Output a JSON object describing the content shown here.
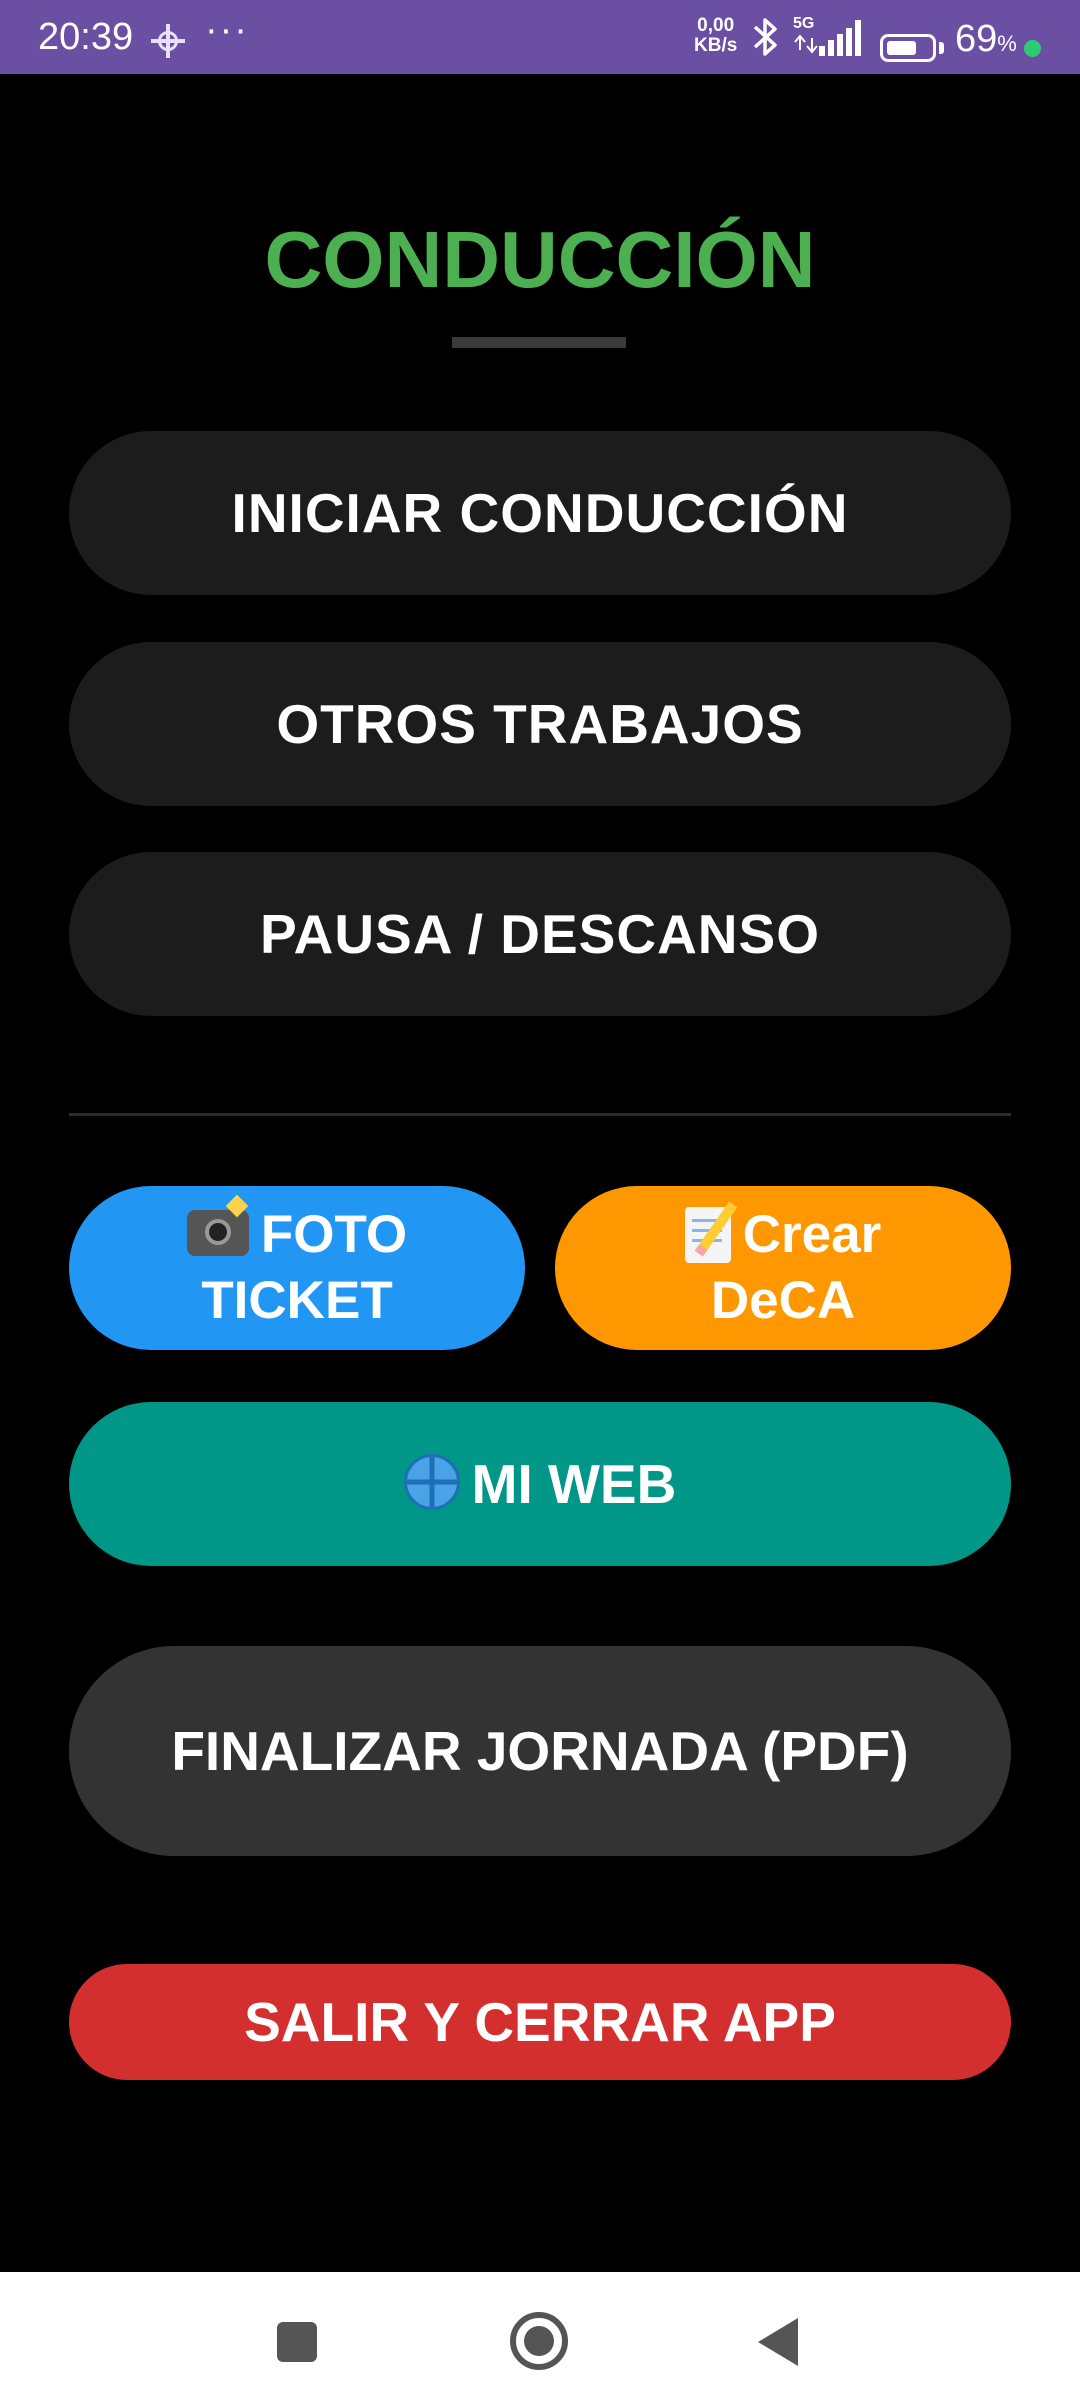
{
  "status_bar": {
    "time": "20:39",
    "more": "···",
    "speed_value": "0,00",
    "speed_unit": "KB/s",
    "network": "5G",
    "battery_percent": "69",
    "battery_unit": "%",
    "battery_level": 0.69,
    "dot_color": "#2ecc71"
  },
  "screen": {
    "title": "CONDUCCIÓN",
    "title_color": "#4caf50"
  },
  "buttons": {
    "start_driving": "INICIAR CONDUCCIÓN",
    "other_work": "OTROS TRABAJOS",
    "pause": "PAUSA / DESCANSO",
    "photo_ticket": {
      "icon": "camera-flash-icon",
      "line1": "FOTO",
      "line2": "TICKET",
      "color": "#2196f3"
    },
    "create_deca": {
      "icon": "memo-icon",
      "line1": "Crear",
      "line2": "DeCA",
      "color": "#ff9800"
    },
    "my_web": {
      "icon": "globe-icon",
      "label": "MI WEB",
      "color": "#009688"
    },
    "finish_day": "FINALIZAR JORNADA (PDF)",
    "exit": {
      "label": "SALIR Y CERRAR APP",
      "color": "#d32f2f"
    }
  },
  "nav_bar": {
    "icons": [
      "recents-icon",
      "home-icon",
      "back-icon"
    ]
  }
}
